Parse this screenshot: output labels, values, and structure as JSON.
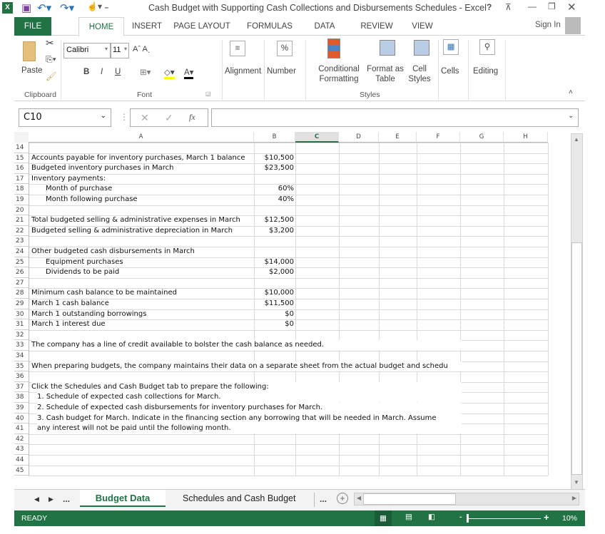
{
  "window": {
    "title": "Cash Budget with Supporting Cash Collections and Disbursements Schedules - Excel",
    "help": "?",
    "sign_in": "Sign In"
  },
  "ribbon_tabs": [
    "FILE",
    "HOME",
    "INSERT",
    "PAGE LAYOUT",
    "FORMULAS",
    "DATA",
    "REVIEW",
    "VIEW"
  ],
  "ribbon": {
    "paste": "Paste",
    "font_name": "Calibri",
    "font_size": "11",
    "bold": "B",
    "italic": "I",
    "underline": "U",
    "alignment": "Alignment",
    "number": "Number",
    "percent": "%",
    "conditional_formatting": [
      "Conditional",
      "Formatting"
    ],
    "format_as_table": [
      "Format as",
      "Table"
    ],
    "cell_styles": [
      "Cell",
      "Styles"
    ],
    "cells": "Cells",
    "editing": "Editing",
    "groups": {
      "clipboard": "Clipboard",
      "font": "Font",
      "styles": "Styles"
    }
  },
  "formula_bar": {
    "name_box": "C10",
    "fx": "fx",
    "formula": ""
  },
  "columns": [
    "A",
    "B",
    "C",
    "D",
    "E",
    "F",
    "G",
    "H"
  ],
  "selected_column": "C",
  "rows": [
    {
      "n": "14",
      "a": "",
      "b": ""
    },
    {
      "n": "15",
      "a": "Accounts payable for inventory purchases, March 1 balance",
      "b": "$10,500"
    },
    {
      "n": "16",
      "a": "Budgeted inventory purchases in March",
      "b": "$23,500"
    },
    {
      "n": "17",
      "a": "Inventory payments:",
      "b": ""
    },
    {
      "n": "18",
      "a": "Month of purchase",
      "b": "60%",
      "indent": true
    },
    {
      "n": "19",
      "a": "Month following purchase",
      "b": "40%",
      "indent": true
    },
    {
      "n": "20",
      "a": "",
      "b": ""
    },
    {
      "n": "21",
      "a": "Total budgeted selling & administrative expenses in March",
      "b": "$12,500"
    },
    {
      "n": "22",
      "a": "Budgeted selling & administrative depreciation in March",
      "b": "$3,200"
    },
    {
      "n": "23",
      "a": "",
      "b": ""
    },
    {
      "n": "24",
      "a": "Other budgeted cash disbursements in March",
      "b": ""
    },
    {
      "n": "25",
      "a": "Equipment purchases",
      "b": "$14,000",
      "indent": true
    },
    {
      "n": "26",
      "a": "Dividends to be paid",
      "b": "$2,000",
      "indent": true
    },
    {
      "n": "27",
      "a": "",
      "b": ""
    },
    {
      "n": "28",
      "a": "Minimum cash balance to be maintained",
      "b": "$10,000"
    },
    {
      "n": "29",
      "a": "March 1 cash balance",
      "b": "$11,500"
    },
    {
      "n": "30",
      "a": "March 1 outstanding borrowings",
      "b": "$0"
    },
    {
      "n": "31",
      "a": "March 1 interest due",
      "b": "$0"
    },
    {
      "n": "32",
      "a": "",
      "b": ""
    },
    {
      "n": "33",
      "a": "The company has a line of credit available to bolster the cash balance as needed.",
      "b": "",
      "overflow": true
    },
    {
      "n": "34",
      "a": "",
      "b": ""
    },
    {
      "n": "35",
      "a": "When preparing budgets, the company maintains their data on a separate sheet from the actual budget and schedu",
      "b": "",
      "overflow": true
    },
    {
      "n": "36",
      "a": "",
      "b": ""
    },
    {
      "n": "37",
      "a": "Click the Schedules and Cash Budget tab to prepare the following:",
      "b": "",
      "overflow": true
    },
    {
      "n": "38",
      "a": "1. Schedule of expected cash collections for March.",
      "b": "",
      "overflow": true,
      "small_indent": true
    },
    {
      "n": "39",
      "a": "2. Schedule of expected cash disbursements for inventory purchases for March.",
      "b": "",
      "overflow": true,
      "small_indent": true
    },
    {
      "n": "40",
      "a": "3. Cash budget for March. Indicate in the financing section any borrowing that will be needed in March.  Assume",
      "b": "",
      "overflow": true,
      "small_indent": true
    },
    {
      "n": "41",
      "a": "any interest will not be paid until the following month.",
      "b": "",
      "overflow": true,
      "small_indent": true
    },
    {
      "n": "42",
      "a": "",
      "b": ""
    },
    {
      "n": "43",
      "a": "",
      "b": ""
    },
    {
      "n": "44",
      "a": "",
      "b": ""
    },
    {
      "n": "45",
      "a": "",
      "b": ""
    }
  ],
  "sheet_tabs": {
    "ellipsis": "...",
    "active": "Budget Data",
    "other": "Schedules and Cash Budget"
  },
  "status": {
    "ready": "READY",
    "zoom": "10%",
    "zoom_level_percent": 10
  },
  "colors": {
    "excel_green": "#217346",
    "tab_green": "#217346"
  }
}
